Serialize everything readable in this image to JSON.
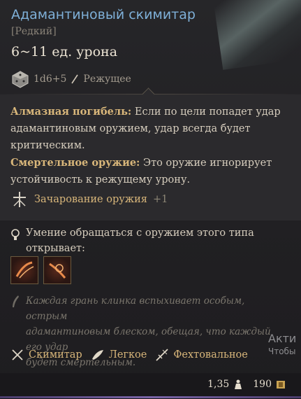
{
  "item": {
    "title": "Адамантиновый скимитар",
    "rarity": "[Редкий]",
    "damage": "6~11 ед. урона",
    "dice": "1d6+5",
    "damage_type": "Режущее"
  },
  "properties": [
    {
      "name": "Алмазная погибель:",
      "text_line1": " Если по цели попадет удар",
      "text_line2": "адамантиновым оружием, удар всегда будет",
      "text_line3": "критическим."
    },
    {
      "name": "Смертельное оружие:",
      "text_line1": " Это оружие игнорирует",
      "text_line2": "устойчивость к режущему урону.",
      "text_line3": ""
    }
  ],
  "enchant": {
    "label": "Зачарование оружия",
    "value": "+1"
  },
  "unlock": {
    "line1": "Умение обращаться с оружием этого типа",
    "line2": "открывает:"
  },
  "flavor": {
    "line1": "Каждая грань клинка вспыхивает особым, острым",
    "line2": "адамантиновым блеском, обещая, что каждый его удар",
    "line3": "будет смертельным."
  },
  "tags": [
    "Скимитар",
    "Легкое",
    "Фехтовальное"
  ],
  "footer": {
    "weight": "1,35",
    "price": "190"
  },
  "watermark": {
    "line1": "Акти",
    "line2": "Чтобы"
  }
}
